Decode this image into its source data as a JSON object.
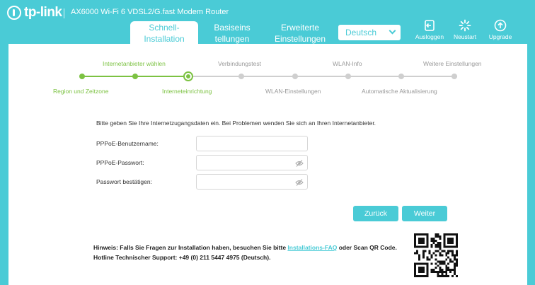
{
  "brand": {
    "logo_text": "tp-link",
    "model": "AX6000 Wi-Fi 6 VDSL2/G.fast Modem Router"
  },
  "tabs": [
    {
      "line1": "Schnell-",
      "line2": "Installation",
      "active": true
    },
    {
      "line1": "Basiseins",
      "line2": "tellungen",
      "active": false
    },
    {
      "line1": "Erweiterte",
      "line2": "Einstellungen",
      "active": false
    }
  ],
  "language": {
    "selected": "Deutsch"
  },
  "actions": {
    "logout": "Ausloggen",
    "reboot": "Neustart",
    "upgrade": "Upgrade"
  },
  "steps": {
    "top": [
      "Internetanbieter wählen",
      "Verbindungstest",
      "WLAN-Info",
      "Weitere Einstellungen"
    ],
    "bottom": [
      "Region und Zeitzone",
      "Interneteinrichtung",
      "WLAN-Einstellungen",
      "Automatische Aktualisierung"
    ],
    "current_index": 2,
    "total": 8
  },
  "form": {
    "intro": "Bitte geben Sie Ihre Internetzugangsdaten ein. Bei Problemen wenden Sie sich an Ihren Internetanbieter.",
    "username_label": "PPPoE-Benutzername:",
    "username_value": "",
    "password_label": "PPPoE-Passwort:",
    "password_value": "",
    "confirm_label": "Passwort bestätigen:",
    "confirm_value": ""
  },
  "buttons": {
    "back": "Zurück",
    "next": "Weiter"
  },
  "hint": {
    "prefix": "Hinweis: Falls Sie Fragen zur Installation haben, besuchen Sie bitte ",
    "link": "Installations-FAQ",
    "suffix": " oder Scan QR Code.",
    "hotline": "Hotline Technischer Support: +49 (0) 211 5447 4975 (Deutsch)."
  },
  "colors": {
    "accent": "#4acbd6",
    "done": "#7cc242",
    "pending": "#cfcfcf"
  }
}
